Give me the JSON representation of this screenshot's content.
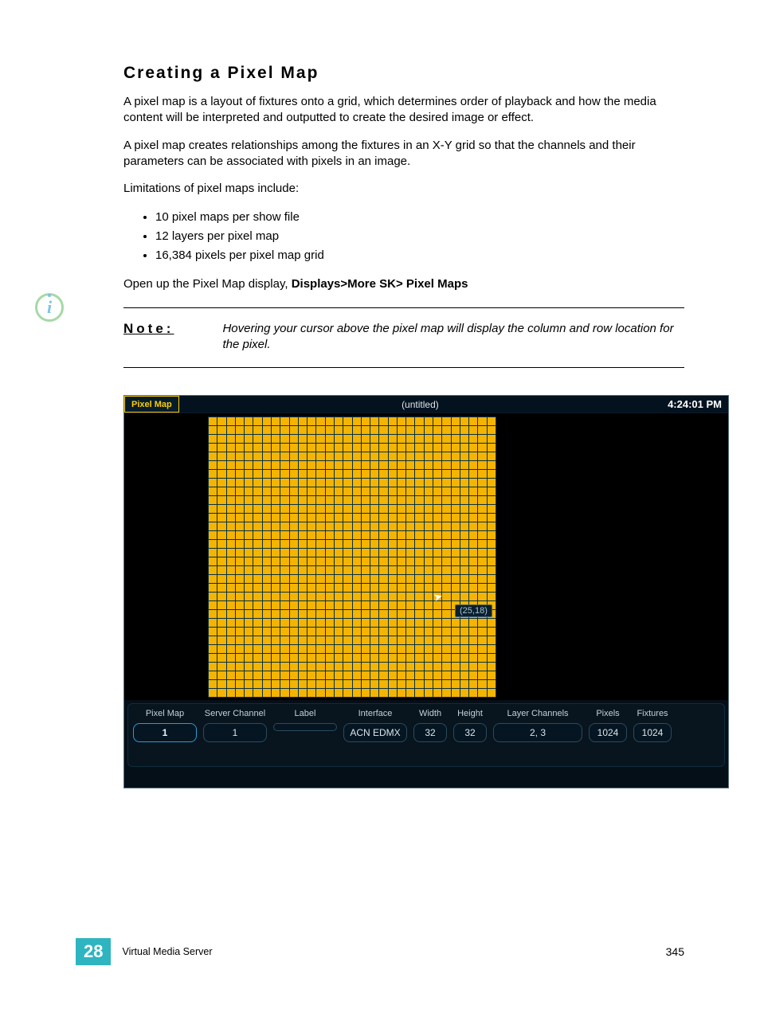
{
  "section": {
    "title": "Creating a Pixel Map",
    "para1": "A pixel map is a layout of fixtures onto a grid, which determines order of playback and how the media content will be interpreted and outputted to create the desired image or effect.",
    "para2": "A pixel map creates relationships among the fixtures in an X-Y grid so that the channels and their parameters can be associated with pixels in an image.",
    "limitations_intro": "Limitations of pixel maps include:",
    "limitations": [
      "10 pixel maps per show file",
      "12 layers per pixel map",
      "16,384 pixels per pixel map grid"
    ],
    "open_instruction_prefix": "Open up the Pixel Map display, ",
    "open_instruction_bold": "Displays>More SK> Pixel Maps"
  },
  "note": {
    "label": "Note:",
    "text": "Hovering your cursor above the pixel map will display the column and row location for the pixel."
  },
  "screenshot": {
    "tab": "Pixel Map",
    "title": "(untitled)",
    "clock": "4:24:01 PM",
    "tooltip": "(25,18)",
    "grid": {
      "cols": 32,
      "rows": 32
    },
    "params": {
      "pixel_map": {
        "label": "Pixel Map",
        "value": "1"
      },
      "server_channel": {
        "label": "Server Channel",
        "value": "1"
      },
      "label_field": {
        "label": "Label",
        "value": ""
      },
      "interface": {
        "label": "Interface",
        "value": "ACN EDMX"
      },
      "width": {
        "label": "Width",
        "value": "32"
      },
      "height": {
        "label": "Height",
        "value": "32"
      },
      "layer_channels": {
        "label": "Layer Channels",
        "value": "2, 3"
      },
      "pixels": {
        "label": "Pixels",
        "value": "1024"
      },
      "fixtures": {
        "label": "Fixtures",
        "value": "1024"
      }
    }
  },
  "footer": {
    "chapter": "28",
    "title": "Virtual Media Server",
    "page": "345"
  }
}
